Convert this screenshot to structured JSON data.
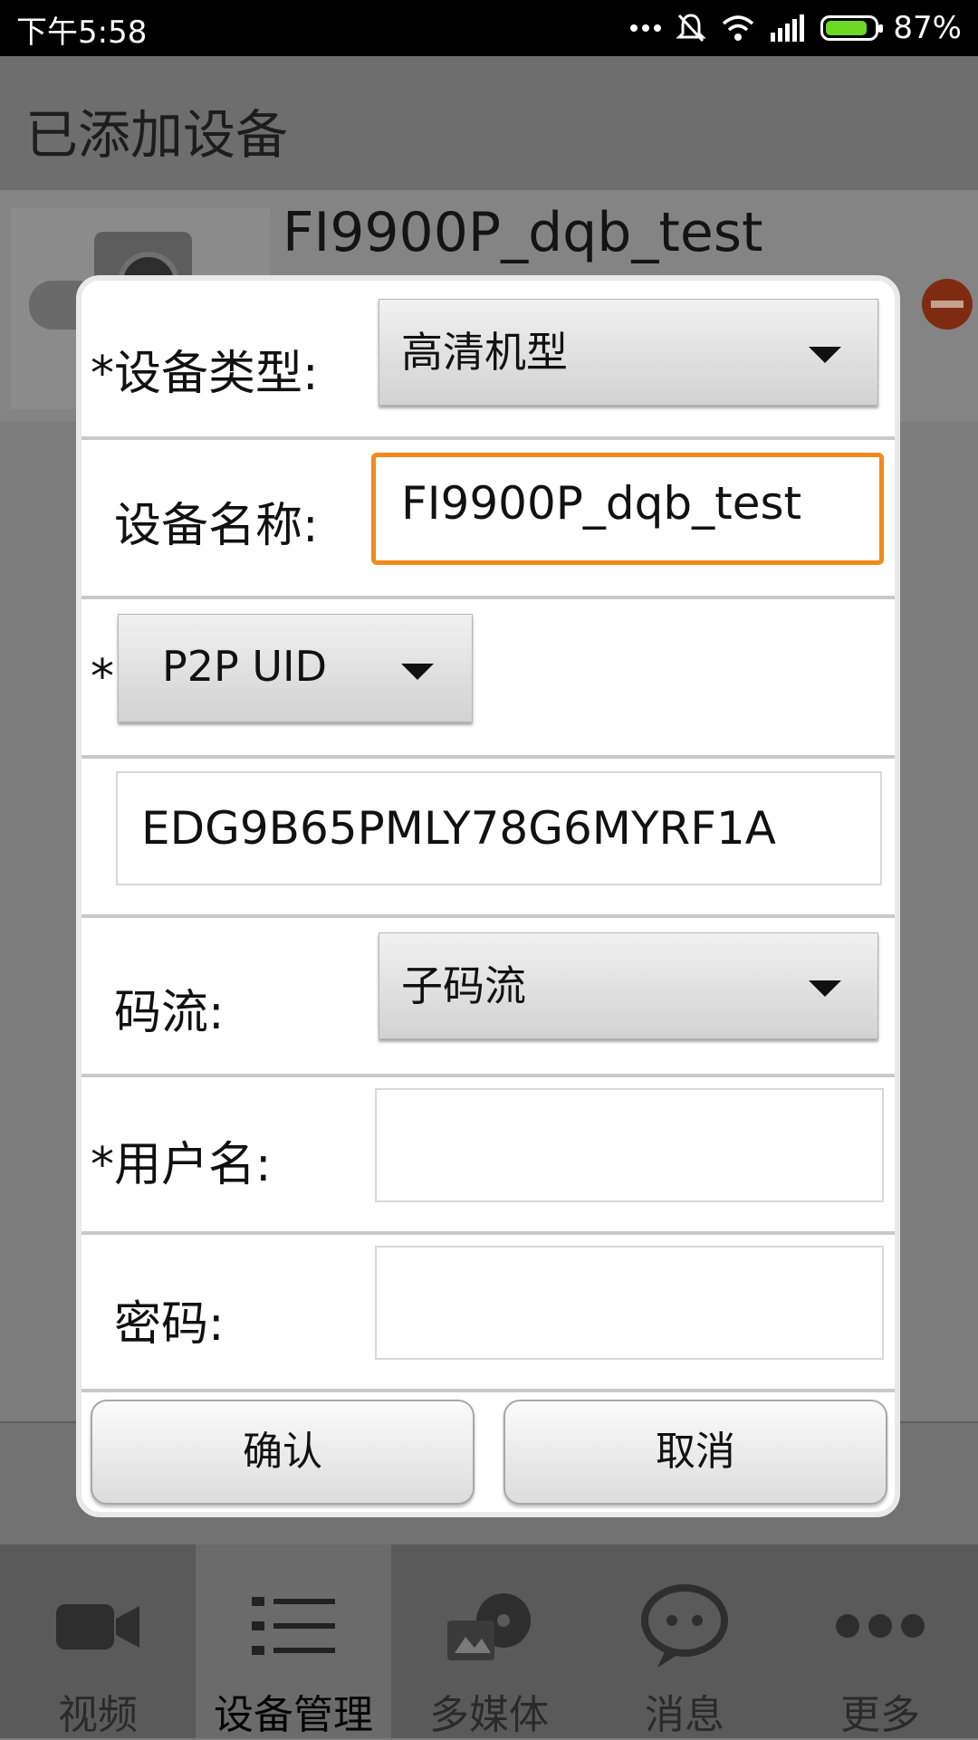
{
  "status_bar": {
    "time": "下午5:58",
    "battery_percent_text": "87%",
    "battery_level": 0.87,
    "icons": [
      "more-dots-icon",
      "mute-icon",
      "wifi-icon",
      "signal-icon",
      "battery-icon"
    ]
  },
  "app": {
    "header_title": "已添加设备",
    "device_name": "FI9900P_dqb_test"
  },
  "dialog": {
    "device_type": {
      "label": "*设备类型:",
      "value": "高清机型"
    },
    "device_name": {
      "label": "设备名称:",
      "value": "FI9900P_dqb_test"
    },
    "connection": {
      "required_mark": "*",
      "value": "P2P UID"
    },
    "uid": {
      "value": "EDG9B65PMLY78G6MYRF1A"
    },
    "stream": {
      "label": "码流:",
      "value": "子码流"
    },
    "username": {
      "label": "*用户名:",
      "value": ""
    },
    "password": {
      "label": "密码:",
      "value": ""
    },
    "confirm_label": "确认",
    "cancel_label": "取消"
  },
  "bottom_nav": {
    "items": [
      {
        "label": "视频",
        "icon": "video-camera-icon"
      },
      {
        "label": "设备管理",
        "icon": "device-list-icon",
        "active": true
      },
      {
        "label": "多媒体",
        "icon": "multimedia-icon"
      },
      {
        "label": "消息",
        "icon": "message-bubble-icon"
      },
      {
        "label": "更多",
        "icon": "more-icon"
      }
    ]
  },
  "colors": {
    "focus_border": "#f1891c",
    "battery_fill": "#6cd826"
  }
}
